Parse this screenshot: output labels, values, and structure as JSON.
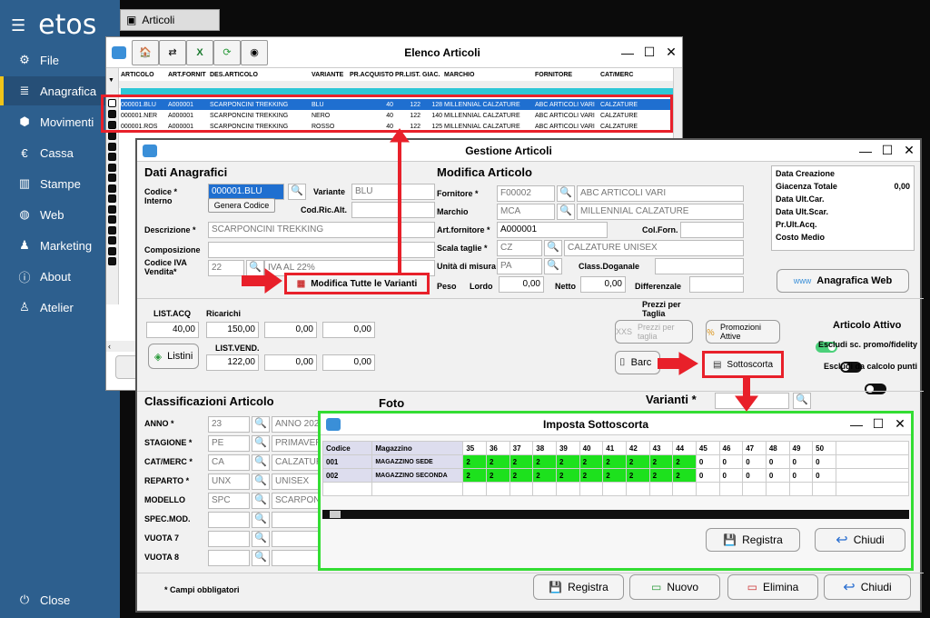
{
  "app": {
    "logo": "etos"
  },
  "nav": [
    {
      "label": "File",
      "icon": "gear-icon"
    },
    {
      "label": "Anagrafica",
      "icon": "database-icon"
    },
    {
      "label": "Movimenti",
      "icon": "cubes-icon"
    },
    {
      "label": "Cassa",
      "icon": "euro-icon"
    },
    {
      "label": "Stampe",
      "icon": "chart-icon"
    },
    {
      "label": "Web",
      "icon": "globe-icon"
    },
    {
      "label": "Marketing",
      "icon": "users-icon"
    },
    {
      "label": "About",
      "icon": "info-icon"
    },
    {
      "label": "Atelier",
      "icon": "person-icon"
    }
  ],
  "close_label": "Close",
  "articoli_tab": "Articoli",
  "elenco": {
    "title": "Elenco Articoli",
    "columns": [
      "ARTICOLO",
      "ART.FORNIT",
      "DES.ARTICOLO",
      "VARIANTE",
      "PR.ACQUISTO",
      "PR.LIST.",
      "GIAC.",
      "MARCHIO",
      "FORNITORE",
      "CAT/MERC"
    ],
    "rows": [
      [
        "000001.BLU",
        "A000001",
        "SCARPONCINI TREKKING",
        "BLU",
        "40",
        "122",
        "128",
        "MILLENNIAL CALZATURE",
        "ABC ARTICOLI VARI",
        "CALZATURE"
      ],
      [
        "000001.NER",
        "A000001",
        "SCARPONCINI TREKKING",
        "NERO",
        "40",
        "122",
        "140",
        "MILLENNIAL CALZATURE",
        "ABC ARTICOLI VARI",
        "CALZATURE"
      ],
      [
        "000001.ROS",
        "A000001",
        "SCARPONCINI TREKKING",
        "ROSSO",
        "40",
        "122",
        "125",
        "MILLENNIAL CALZATURE",
        "ABC ARTICOLI VARI",
        "CALZATURE"
      ]
    ]
  },
  "gestione": {
    "title": "Gestione Articoli",
    "dati_anagrafici": "Dati Anagrafici",
    "modifica_articolo": "Modifica Articolo",
    "codice_label": "Codice * Interno",
    "codice_value": "000001.BLU",
    "genera_codice": "Genera Codice",
    "variante_label": "Variante",
    "variante_value": "BLU",
    "codricalt_label": "Cod.Ric.Alt.",
    "descrizione_label": "Descrizione *",
    "descrizione_value": "SCARPONCINI TREKKING",
    "composizione_label": "Composizione",
    "iva_label": "Codice IVA Vendita*",
    "iva_code": "22",
    "iva_desc": "IVA AL 22%",
    "modifica_varianti": "Modifica Tutte le Varianti",
    "fornitore_label": "Fornitore *",
    "fornitore_code": "F00002",
    "fornitore_desc": "ABC ARTICOLI VARI",
    "marchio_label": "Marchio",
    "marchio_code": "MCA",
    "marchio_desc": "MILLENNIAL CALZATURE",
    "artforn_label": "Art.fornitore *",
    "artforn_value": "A000001",
    "colforn_label": "Col.Forn.",
    "scala_label": "Scala taglie *",
    "scala_code": "CZ",
    "scala_desc": "CALZATURE UNISEX",
    "um_label": "Unità di misura",
    "um_value": "PA",
    "classdog_label": "Class.Doganale",
    "peso_label": "Peso",
    "lordo_label": "Lordo",
    "lordo_value": "0,00",
    "netto_label": "Netto",
    "netto_value": "0,00",
    "diff_label": "Differenzale",
    "info": [
      {
        "label": "Data Creazione",
        "value": ""
      },
      {
        "label": "Giacenza Totale",
        "value": "0,00"
      },
      {
        "label": "Data Ult.Car.",
        "value": ""
      },
      {
        "label": "Data Ult.Scar.",
        "value": ""
      },
      {
        "label": "Pr.Ult.Acq.",
        "value": ""
      },
      {
        "label": "Costo Medio",
        "value": ""
      }
    ],
    "anagrafica_web": "Anagrafica Web",
    "list_acq_label": "LIST.ACQ",
    "list_acq_value": "40,00",
    "ricarichi_label": "Ricarichi",
    "ricarichi": [
      "150,00",
      "0,00",
      "0,00"
    ],
    "listini": "Listini",
    "list_vend_label": "LIST.VEND.",
    "list_vend": [
      "122,00",
      "0,00",
      "0,00"
    ],
    "prezzi_taglia": "Prezzi per Taglia",
    "prezzi_taglia_btn": "Prezzi per taglia",
    "promozioni": "Promozioni Attive",
    "articolo_attivo": "Articolo Attivo",
    "escludi_promo": "Escludi sc. promo/fidelity",
    "escludi_punti": "Escludi da calcolo punti",
    "barcode": "Barc",
    "sottoscorta": "Sottoscorta",
    "classificazioni": "Classificazioni Articolo",
    "foto": "Foto",
    "varianti": "Varianti *",
    "class_rows": [
      {
        "label": "ANNO *",
        "code": "23",
        "desc": "ANNO 2023"
      },
      {
        "label": "STAGIONE *",
        "code": "PE",
        "desc": "PRIMAVERA"
      },
      {
        "label": "CAT/MERC *",
        "code": "CA",
        "desc": "CALZATURE"
      },
      {
        "label": "REPARTO *",
        "code": "UNX",
        "desc": "UNISEX"
      },
      {
        "label": "MODELLO",
        "code": "SPC",
        "desc": "SCARPONC"
      },
      {
        "label": "SPEC.MOD.",
        "code": "",
        "desc": ""
      },
      {
        "label": "VUOTA 7",
        "code": "",
        "desc": ""
      },
      {
        "label": "VUOTA 8",
        "code": "",
        "desc": ""
      }
    ],
    "campi_obbligatori": "* Campi obbligatori",
    "registra": "Registra",
    "nuovo": "Nuovo",
    "elimina": "Elimina",
    "chiudi": "Chiudi"
  },
  "sottoscorta": {
    "title": "Imposta Sottoscorta",
    "col_codice": "Codice",
    "col_magazzino": "Magazzino",
    "sizes": [
      "35",
      "36",
      "37",
      "38",
      "39",
      "40",
      "41",
      "42",
      "43",
      "44",
      "45",
      "46",
      "47",
      "48",
      "49",
      "50"
    ],
    "rows": [
      {
        "code": "001",
        "name": "MAGAZZINO SEDE",
        "values": [
          "2",
          "2",
          "2",
          "2",
          "2",
          "2",
          "2",
          "2",
          "2",
          "2",
          "0",
          "0",
          "0",
          "0",
          "0",
          "0"
        ]
      },
      {
        "code": "002",
        "name": "MAGAZZINO SECONDA",
        "values": [
          "2",
          "2",
          "2",
          "2",
          "2",
          "2",
          "2",
          "2",
          "2",
          "2",
          "0",
          "0",
          "0",
          "0",
          "0",
          "0"
        ]
      }
    ],
    "registra": "Registra",
    "chiudi": "Chiudi"
  },
  "colors": {
    "sidebar": "#2d5f8e",
    "highlight_red": "#e8202a",
    "highlight_green": "#33dd33",
    "cell_green": "#1de11d"
  }
}
